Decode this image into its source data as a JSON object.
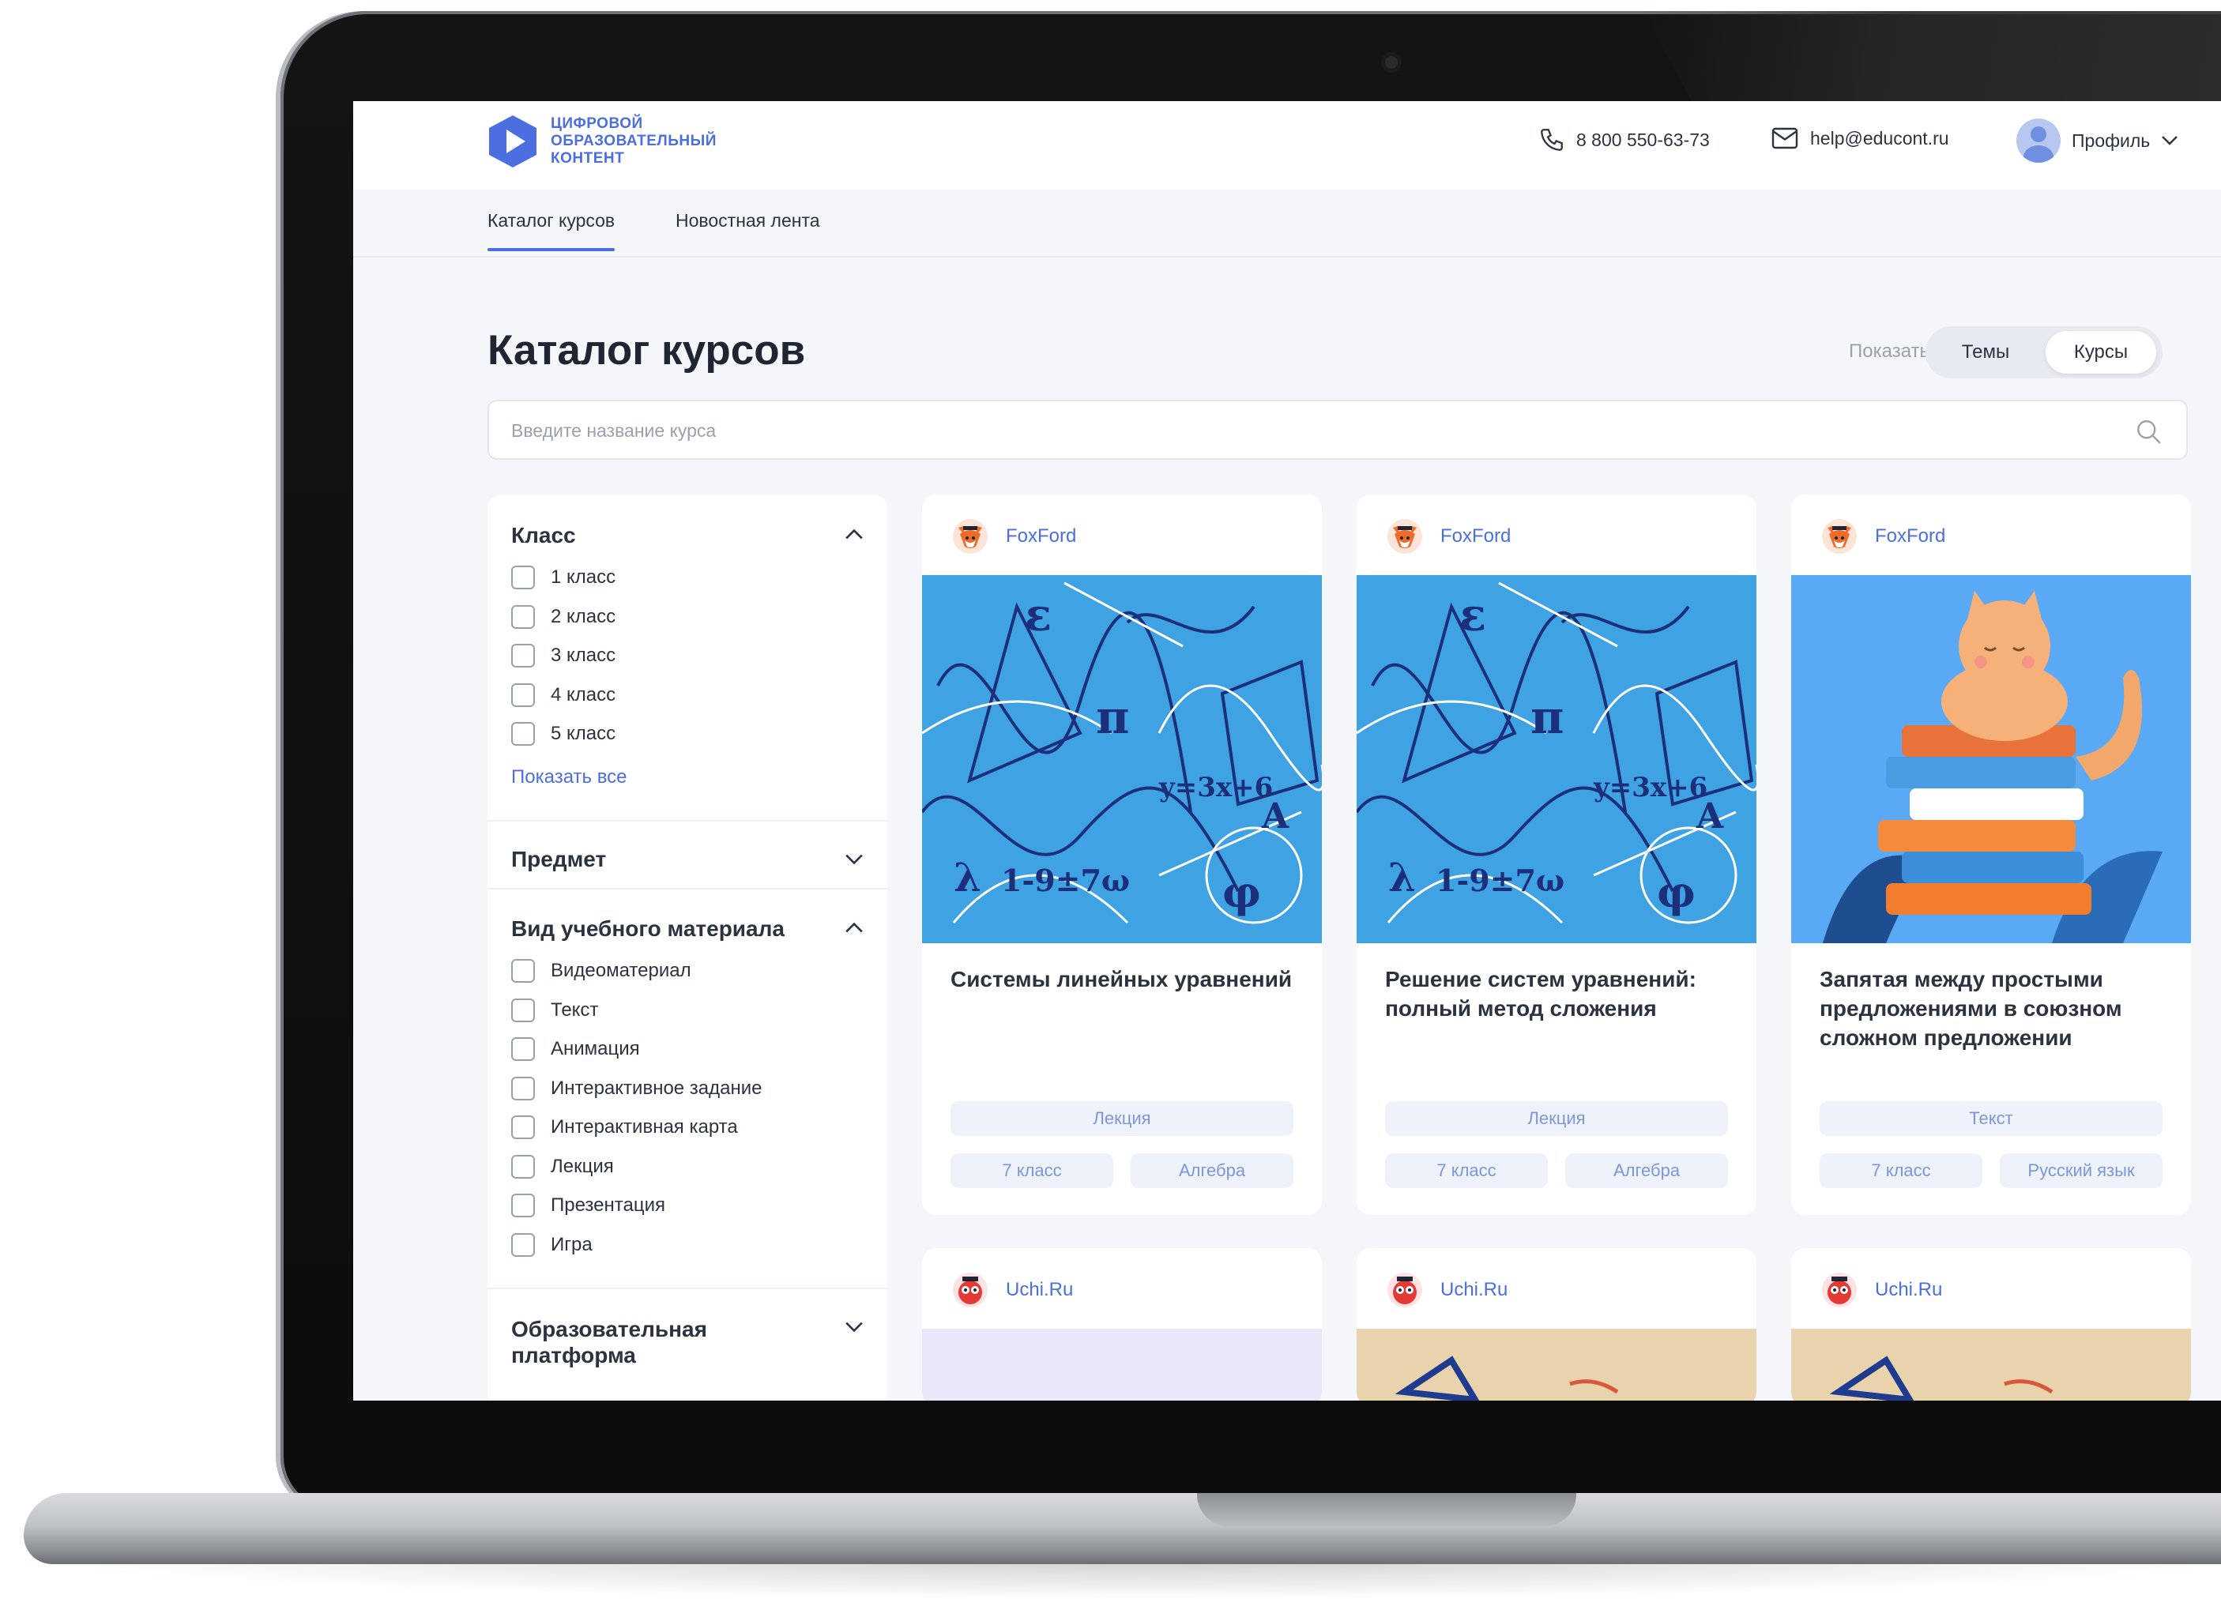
{
  "header": {
    "logo_lines": [
      "ЦИФРОВОЙ",
      "ОБРАЗОВАТЕЛЬНЫЙ",
      "КОНТЕНТ"
    ],
    "phone": "8 800 550-63-73",
    "email": "help@educont.ru",
    "profile_label": "Профиль"
  },
  "nav": {
    "tabs": [
      {
        "label": "Каталог курсов",
        "active": true
      },
      {
        "label": "Новостная лента",
        "active": false
      }
    ]
  },
  "page": {
    "title": "Каталог курсов",
    "show_label": "Показать",
    "view_options": [
      "Темы",
      "Курсы"
    ],
    "selected_view": "Курсы"
  },
  "search": {
    "placeholder": "Введите название курса",
    "value": ""
  },
  "filters": {
    "grade": {
      "title": "Класс",
      "expanded": true,
      "options": [
        "1 класс",
        "2 класс",
        "3 класс",
        "4 класс",
        "5 класс"
      ],
      "show_all": "Показать все"
    },
    "subject": {
      "title": "Предмет",
      "expanded": false
    },
    "material_type": {
      "title": "Вид учебного материала",
      "expanded": true,
      "options": [
        "Видеоматериал",
        "Текст",
        "Анимация",
        "Интерактивное задание",
        "Интерактивная карта",
        "Лекция",
        "Презентация",
        "Игра"
      ]
    },
    "platform": {
      "title_lines": [
        "Образовательная",
        "платформа"
      ],
      "expanded": false
    }
  },
  "cards": [
    {
      "provider": "FoxFord",
      "title": "Системы линейных уравнений",
      "type": "Лекция",
      "grade": "7 класс",
      "subject": "Алгебра",
      "image": "math-pattern"
    },
    {
      "provider": "FoxFord",
      "title": "Решение систем уравнений: полный метод сложения",
      "type": "Лекция",
      "grade": "7 класс",
      "subject": "Алгебра",
      "image": "math-pattern"
    },
    {
      "provider": "FoxFord",
      "title": "Запятая между простыми предложениями в союзном сложном предложении",
      "type": "Текст",
      "grade": "7 класс",
      "subject": "Русский язык",
      "image": "cat-books"
    },
    {
      "provider": "Uchi.Ru",
      "image": "lavender"
    },
    {
      "provider": "Uchi.Ru",
      "image": "beige-map"
    },
    {
      "provider": "Uchi.Ru",
      "image": "beige-map"
    }
  ],
  "colors": {
    "accent": "#4b6ee0",
    "screen_bg": "#f4f6f9",
    "tag_bg": "#eef2fb",
    "math_bg": "#3fa3e3",
    "cat_bg": "#5aa9f5"
  }
}
